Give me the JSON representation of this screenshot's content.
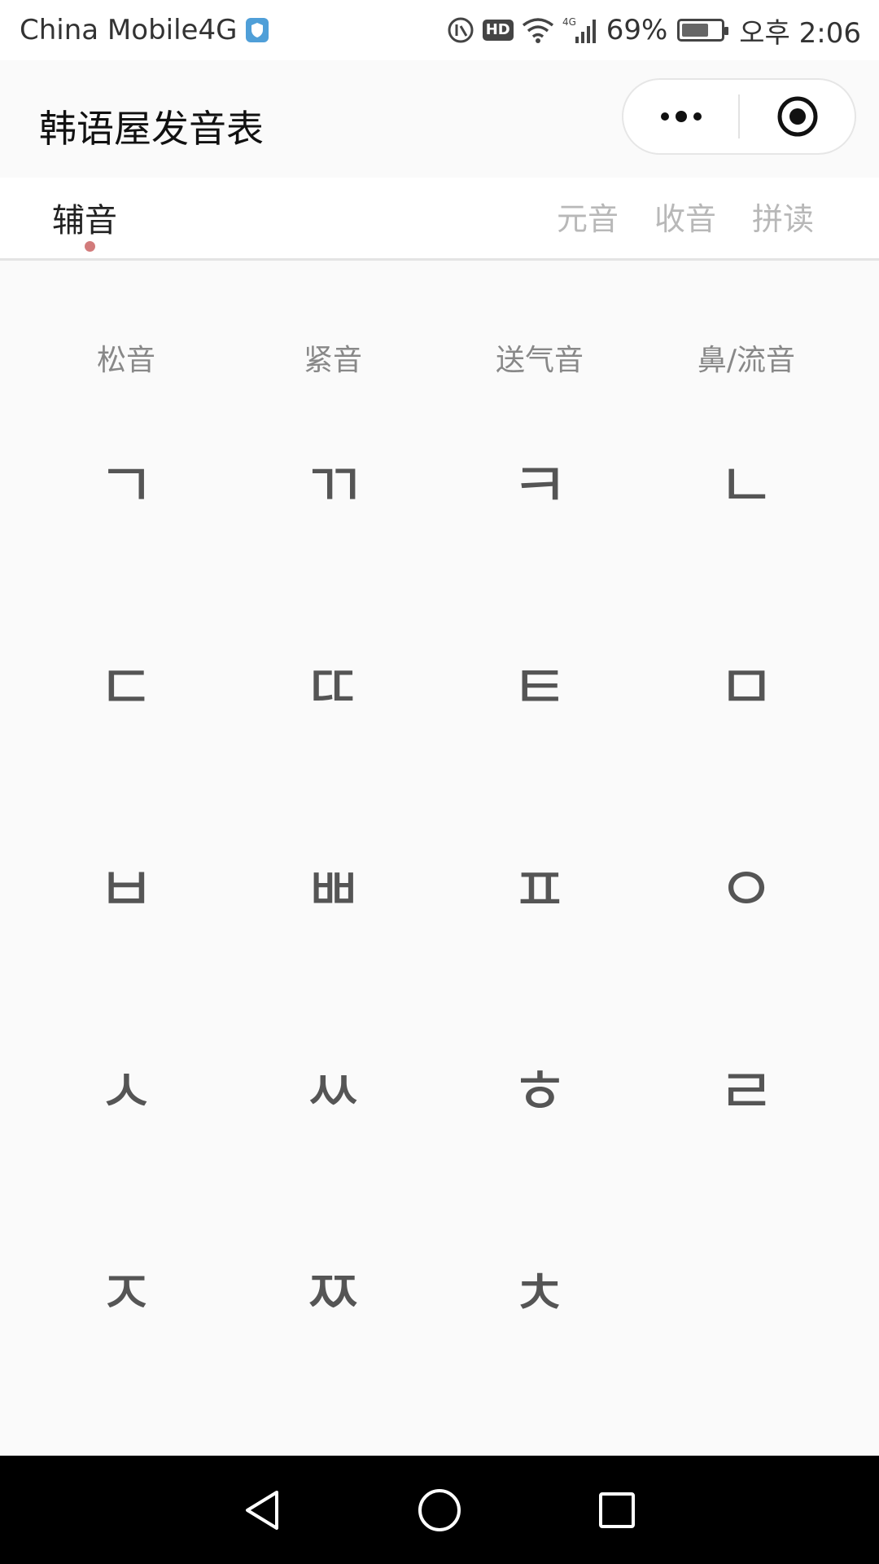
{
  "status_bar": {
    "carrier": "China Mobile4G",
    "battery": "69%",
    "time": "오후 2:06",
    "hd": "HD",
    "network": "4G",
    "battery_level": 0.69
  },
  "header": {
    "title": "韩语屋发音表"
  },
  "tabs": [
    {
      "label": "辅音",
      "active": true
    },
    {
      "label": "元音",
      "active": false
    },
    {
      "label": "收音",
      "active": false
    },
    {
      "label": "拼读",
      "active": false
    }
  ],
  "columns": [
    "松音",
    "紧音",
    "送气音",
    "鼻/流音"
  ],
  "letters": [
    [
      "ㄱ",
      "ㄲ",
      "ㅋ",
      "ㄴ"
    ],
    [
      "ㄷ",
      "ㄸ",
      "ㅌ",
      "ㅁ"
    ],
    [
      "ㅂ",
      "ㅃ",
      "ㅍ",
      "ㅇ"
    ],
    [
      "ㅅ",
      "ㅆ",
      "ㅎ",
      "ㄹ"
    ],
    [
      "ㅈ",
      "ㅉ",
      "ㅊ",
      ""
    ]
  ],
  "colors": {
    "accent_dot": "#d27b7b",
    "letter": "#555555",
    "inactive_tab": "#b8b8b8"
  },
  "icons": {
    "status_shield": "shield-icon",
    "more": "more-dots-icon",
    "close": "target-circle-icon",
    "back": "back-triangle-icon",
    "home": "home-circle-icon",
    "recent": "recent-square-icon"
  }
}
